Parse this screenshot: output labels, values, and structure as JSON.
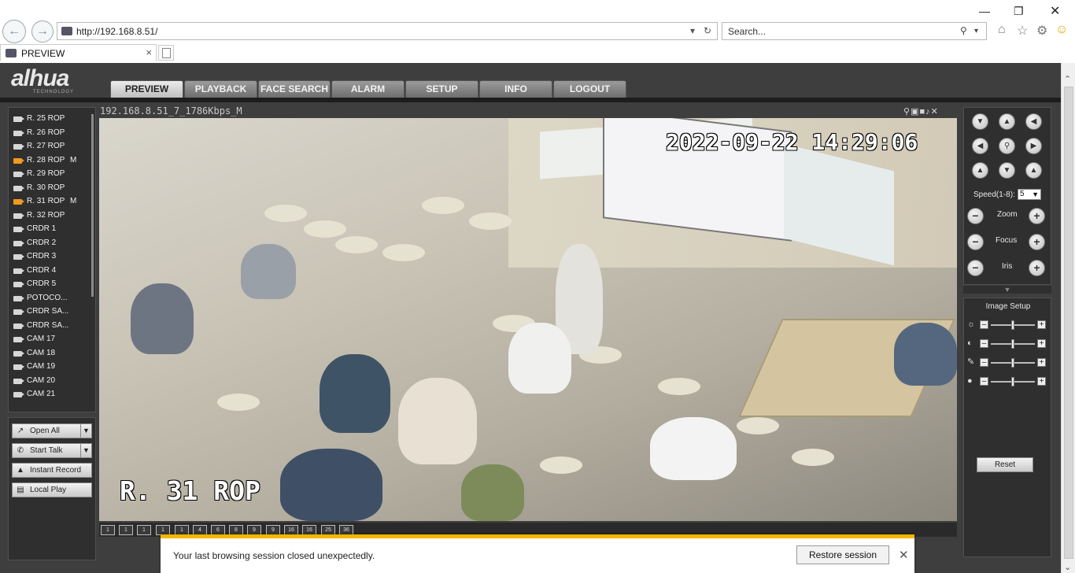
{
  "browser": {
    "url": "http://192.168.8.51/",
    "search_placeholder": "Search...",
    "tab_title": "PREVIEW"
  },
  "app": {
    "logo": "alhua",
    "logo_sub": "TECHNOLOGY",
    "menu": [
      "PREVIEW",
      "PLAYBACK",
      "FACE SEARCH",
      "ALARM",
      "SETUP",
      "INFO",
      "LOGOUT"
    ],
    "active_menu": "PREVIEW"
  },
  "channels": [
    {
      "name": "R. 25 ROP",
      "recording": false,
      "mark": ""
    },
    {
      "name": "R. 26 ROP",
      "recording": false,
      "mark": ""
    },
    {
      "name": "R. 27 ROP",
      "recording": false,
      "mark": ""
    },
    {
      "name": "R. 28 ROP",
      "recording": true,
      "mark": "M"
    },
    {
      "name": "R. 29 ROP",
      "recording": false,
      "mark": ""
    },
    {
      "name": "R. 30 ROP",
      "recording": false,
      "mark": ""
    },
    {
      "name": "R. 31 ROP",
      "recording": true,
      "mark": "M"
    },
    {
      "name": "R. 32 ROP",
      "recording": false,
      "mark": ""
    },
    {
      "name": "CRDR 1",
      "recording": false,
      "mark": ""
    },
    {
      "name": "CRDR 2",
      "recording": false,
      "mark": ""
    },
    {
      "name": "CRDR 3",
      "recording": false,
      "mark": ""
    },
    {
      "name": "CRDR 4",
      "recording": false,
      "mark": ""
    },
    {
      "name": "CRDR 5",
      "recording": false,
      "mark": ""
    },
    {
      "name": "POTOCO...",
      "recording": false,
      "mark": ""
    },
    {
      "name": "CRDR SA...",
      "recording": false,
      "mark": ""
    },
    {
      "name": "CRDR SA...",
      "recording": false,
      "mark": ""
    },
    {
      "name": "CAM 17",
      "recording": false,
      "mark": ""
    },
    {
      "name": "CAM 18",
      "recording": false,
      "mark": ""
    },
    {
      "name": "CAM 19",
      "recording": false,
      "mark": ""
    },
    {
      "name": "CAM 20",
      "recording": false,
      "mark": ""
    },
    {
      "name": "CAM 21",
      "recording": false,
      "mark": ""
    }
  ],
  "controls": {
    "open_all": "Open All",
    "start_talk": "Start Talk",
    "instant_record": "Instant Record",
    "local_play": "Local Play"
  },
  "video": {
    "stream_info": "192.168.8.51_7_1786Kbps_M",
    "timestamp": "2022-09-22 14:29:06",
    "camera_label": "R. 31 ROP"
  },
  "split_modes": [
    "1",
    "1",
    "1",
    "1",
    "1",
    "4",
    "6",
    "8",
    "9",
    "9",
    "16",
    "16",
    "25",
    "36"
  ],
  "ptz": {
    "speed_label": "Speed(1-8):",
    "speed_value": "5",
    "zoom": "Zoom",
    "focus": "Focus",
    "iris": "Iris"
  },
  "image_setup": {
    "title": "Image Setup",
    "reset": "Reset",
    "levels": [
      0.5,
      0.5,
      0.5,
      0.5
    ]
  },
  "notification": {
    "message": "Your last browsing session closed unexpectedly.",
    "button": "Restore session"
  }
}
